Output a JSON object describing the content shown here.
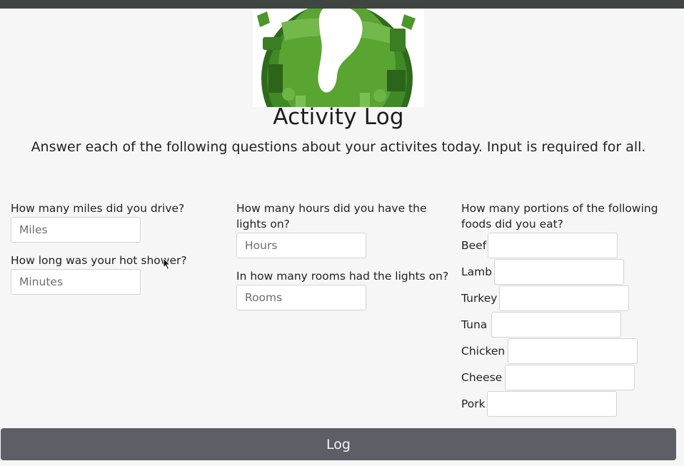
{
  "header": {
    "title": "Activity Log",
    "subtitle": "Answer each of the following questions about your activites today. Input is required for all."
  },
  "logo": {
    "icon": "green-earth-footprint-icon",
    "colors": {
      "earth": "#4f9a2e",
      "footprint": "#ffffff",
      "dark": "#2f6a1c"
    }
  },
  "column1": {
    "q1": {
      "label": "How many miles did you drive?",
      "placeholder": "Miles"
    },
    "q2": {
      "label": "How long was your hot shower?",
      "placeholder": "Minutes"
    }
  },
  "column2": {
    "q1": {
      "label_line1": "How many hours did you have the",
      "label_line2": "lights on?",
      "placeholder": "Hours"
    },
    "q2": {
      "label": "In how many rooms had the lights on?",
      "placeholder": "Rooms"
    }
  },
  "column3": {
    "label_line1": "How many portions of the following",
    "label_line2": "foods did you eat?",
    "foods": [
      {
        "label": "Beef",
        "value": ""
      },
      {
        "label": "Lamb",
        "value": ""
      },
      {
        "label": "Turkey",
        "value": ""
      },
      {
        "label": "Tuna",
        "value": ""
      },
      {
        "label": "Chicken",
        "value": ""
      },
      {
        "label": "Cheese",
        "value": ""
      },
      {
        "label": "Pork",
        "value": ""
      }
    ]
  },
  "footer": {
    "log_label": "Log"
  },
  "colors": {
    "button_bg": "#5c6066",
    "top_bar": "#3f4540",
    "page_bg": "#f6f6f7"
  }
}
